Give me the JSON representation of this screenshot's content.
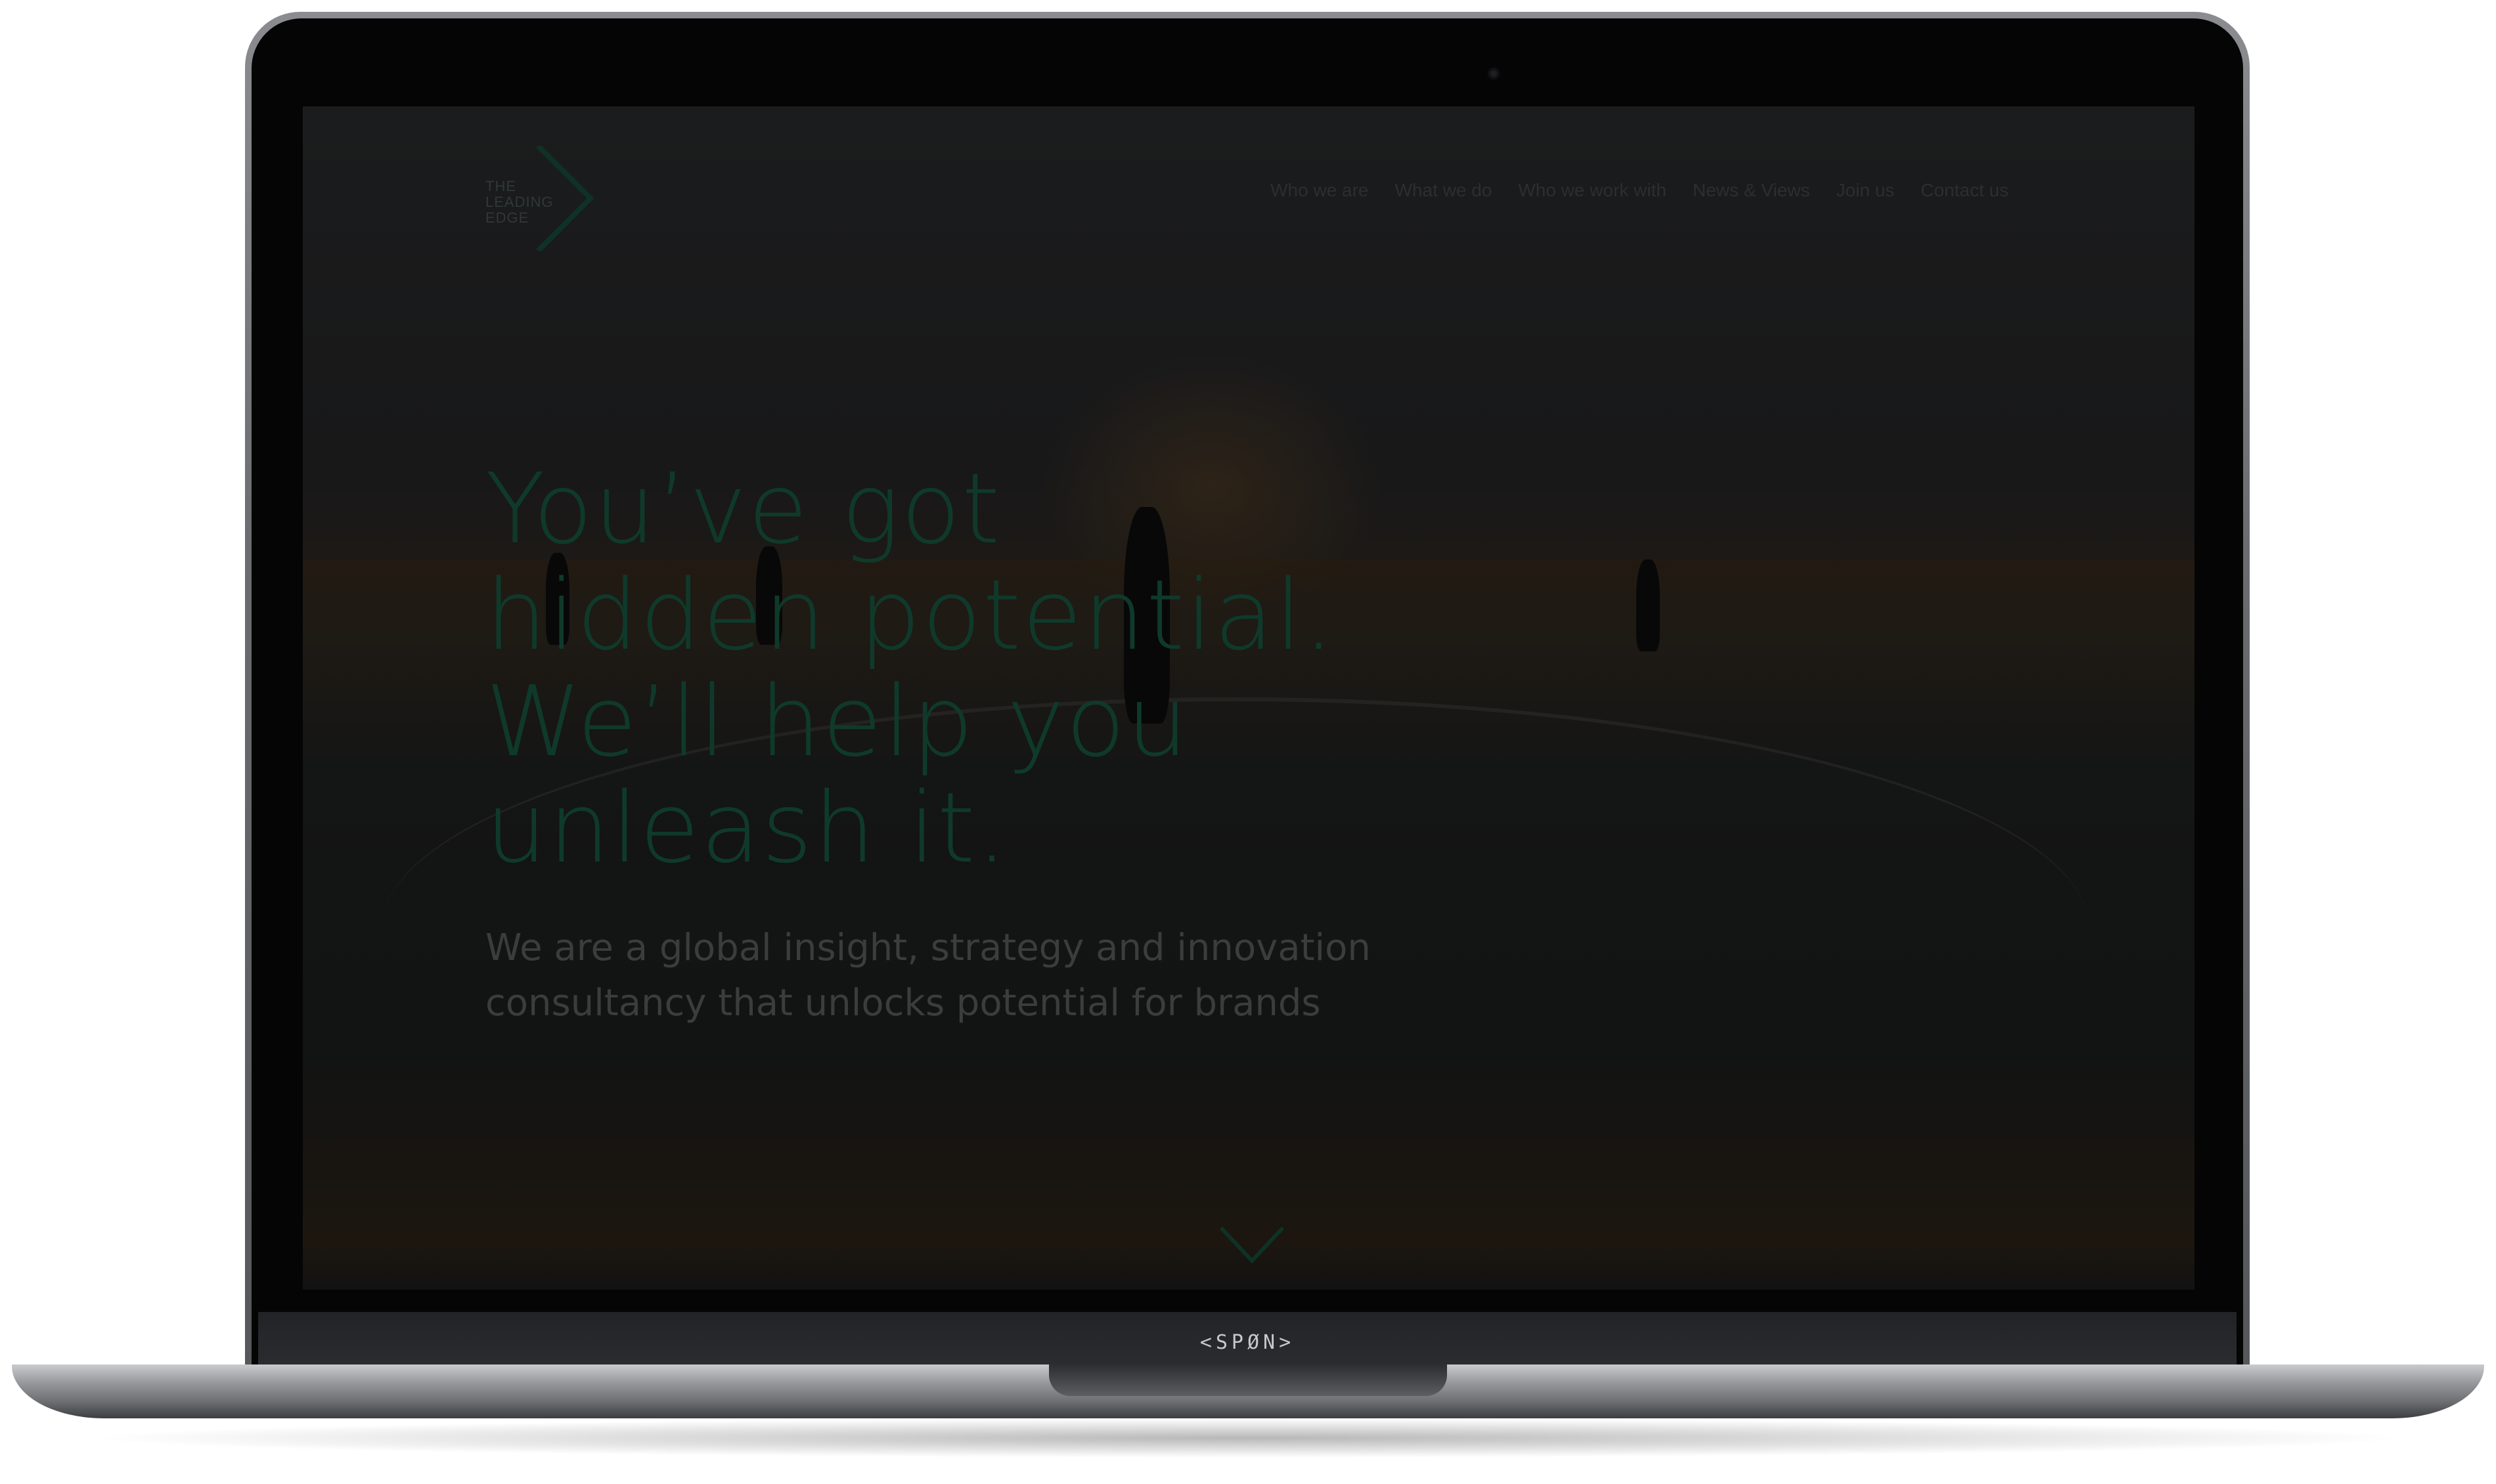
{
  "header": {
    "logo": {
      "lines": [
        "THE",
        "LEADING",
        "EDGE"
      ],
      "icon": "chevron-right-icon"
    },
    "nav": [
      {
        "label": "Who we are"
      },
      {
        "label": "What we do"
      },
      {
        "label": "Who we work with"
      },
      {
        "label": "News & Views"
      },
      {
        "label": "Join us"
      },
      {
        "label": "Contact us"
      }
    ]
  },
  "hero": {
    "heading_lines": [
      "You’ve got",
      "hidden potential.",
      "We’ll help you",
      "unleash it."
    ],
    "subheading_lines": [
      "We are a global insight, strategy and innovation",
      "consultancy that unlocks potential for brands"
    ],
    "scroll_icon": "chevron-down-icon"
  },
  "device": {
    "brand_label": "<SPØN>"
  },
  "colors": {
    "accent": "#0f3a2b",
    "screen_bg": "#161717",
    "nav_text": "#2c2f2e"
  }
}
